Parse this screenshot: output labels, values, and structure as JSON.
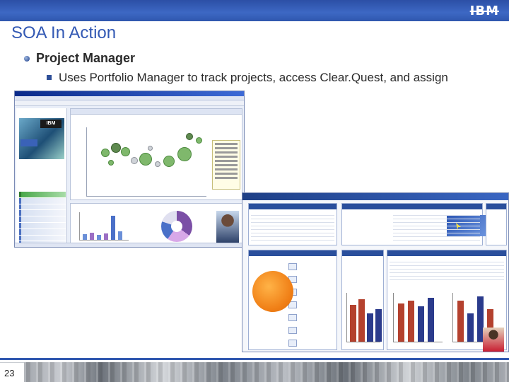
{
  "header": {
    "logo_text": "IBM",
    "brand_color": "#2f57ad"
  },
  "slide": {
    "title": "SOA In Action",
    "bullet_level1": "Project Manager",
    "bullet_level2": "Uses Portfolio Manager to track projects, access Clear.Quest, and assign",
    "page_number": "23"
  },
  "screenshots": {
    "portfolio_window": {
      "description_icon": "portfolio-manager-window"
    },
    "dashboard_window": {
      "description_icon": "project-dashboard-window"
    }
  },
  "colors": {
    "title": "#3359b4",
    "accent_orange": "#f07f16",
    "bubble_green": "#7fb86c"
  }
}
